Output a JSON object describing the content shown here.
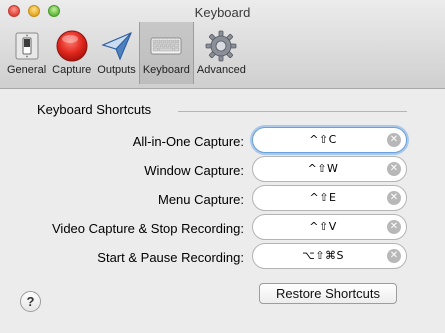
{
  "window": {
    "title": "Keyboard"
  },
  "toolbar": {
    "items": [
      {
        "label": "General",
        "icon": "general-switch-icon"
      },
      {
        "label": "Capture",
        "icon": "capture-record-icon"
      },
      {
        "label": "Outputs",
        "icon": "outputs-plane-icon"
      },
      {
        "label": "Keyboard",
        "icon": "keyboard-icon",
        "selected": true
      },
      {
        "label": "Advanced",
        "icon": "gear-icon"
      }
    ]
  },
  "shortcuts": {
    "section_title": "Keyboard Shortcuts",
    "rows": [
      {
        "label": "All-in-One Capture:",
        "keys": "^⇧C"
      },
      {
        "label": "Window Capture:",
        "keys": "^⇧W"
      },
      {
        "label": "Menu Capture:",
        "keys": "^⇧E"
      },
      {
        "label": "Video Capture & Stop Recording:",
        "keys": "^⇧V"
      },
      {
        "label": "Start & Pause Recording:",
        "keys": "⌥⇧⌘S"
      }
    ]
  },
  "footer": {
    "help_label": "?",
    "restore_label": "Restore Shortcuts"
  },
  "colors": {
    "capture_red": "#e0281e",
    "focus_ring": "#6aa1d8"
  }
}
